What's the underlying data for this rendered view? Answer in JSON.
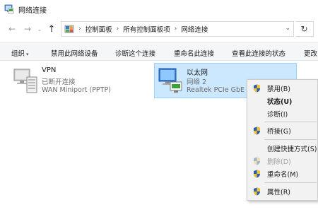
{
  "window": {
    "title": "网络连接"
  },
  "nav": {
    "back_glyph": "←",
    "forward_glyph": "→",
    "recent_glyph": "⌄",
    "up_glyph": "↑",
    "breadcrumb": [
      "控制面板",
      "所有控制面板项",
      "网络连接"
    ],
    "separator_glyph": "›",
    "dropdown_glyph": "⌄",
    "refresh_glyph": "↻"
  },
  "commands": {
    "organize": "组织",
    "organize_caret": "▾",
    "disable": "禁用此网络设备",
    "diagnose": "诊断这个连接",
    "rename": "重命名此连接",
    "view_status": "查看此连接的状态",
    "more": "更改"
  },
  "connections": {
    "vpn": {
      "name": "VPN",
      "status": "已断开连接",
      "device": "WAN Miniport (PPTP)"
    },
    "ethernet": {
      "name": "以太网",
      "network": "网络 2",
      "device": "Realtek PCIe GbE"
    }
  },
  "context_menu": {
    "items": [
      {
        "label": "禁用(B)",
        "shield": true,
        "bold": false,
        "disabled": false
      },
      {
        "label": "状态(U)",
        "shield": false,
        "bold": true,
        "disabled": false
      },
      {
        "label": "诊断(I)",
        "shield": false,
        "bold": false,
        "disabled": false
      },
      {
        "label": "桥接(G)",
        "shield": true,
        "bold": false,
        "disabled": false
      },
      {
        "label": "创建快捷方式(S)",
        "shield": false,
        "bold": false,
        "disabled": false
      },
      {
        "label": "删除(D)",
        "shield": true,
        "bold": false,
        "disabled": true
      },
      {
        "label": "重命名(M)",
        "shield": true,
        "bold": false,
        "disabled": false
      },
      {
        "label": "属性(R)",
        "shield": true,
        "bold": false,
        "disabled": false
      }
    ]
  },
  "colors": {
    "selection_bg": "#cce8ff",
    "selection_border": "#99d1ff",
    "menu_bg": "#f2f2f2",
    "commandbar_bg": "#f5f6f7"
  }
}
